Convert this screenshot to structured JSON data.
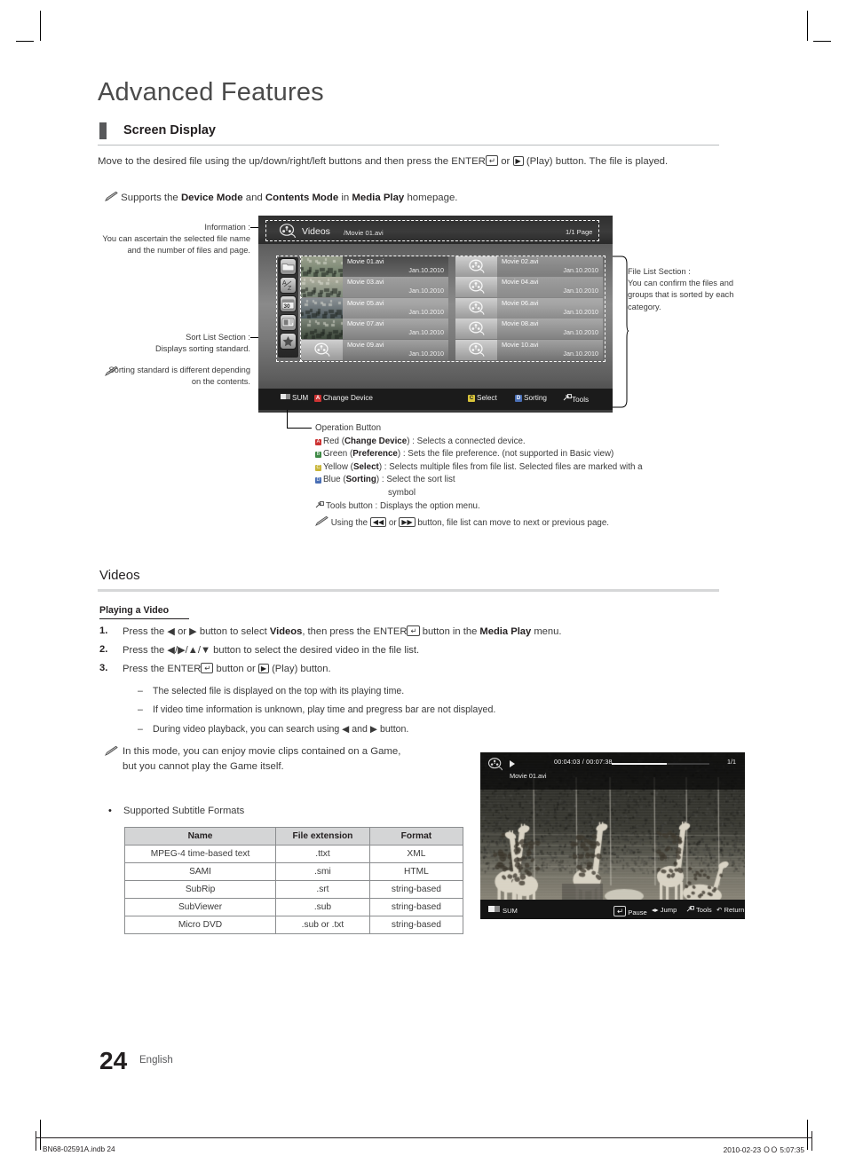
{
  "page": {
    "title": "Advanced Features",
    "number": "24",
    "language": "English"
  },
  "screen_display": {
    "heading": "Screen Display",
    "intro_1": "Move to the desired file using the up/down/right/left buttons and then press the ENTER",
    "intro_enter_key": "↵",
    "intro_2": "or",
    "intro_play_key": "▶",
    "intro_3": "(Play) button. The file is played.",
    "note_pre": "Supports the ",
    "note_b1": "Device Mode",
    "note_mid1": " and ",
    "note_b2": "Contents Mode",
    "note_mid2": " in ",
    "note_b3": "Media Play",
    "note_end": " homepage."
  },
  "callouts": {
    "information": {
      "title": "Information :",
      "body": "You can ascertain the selected file name and the number of files and page."
    },
    "sort_list": {
      "title": "Sort List Section :",
      "body": "Displays sorting standard.",
      "note": "Sorting standard is different depending on the contents."
    },
    "file_list": {
      "title": "File List Section :",
      "body": "You can confirm the files and groups that is sorted by each category."
    }
  },
  "tv_screen": {
    "header": {
      "icon": "film-reel-icon",
      "title": "Videos",
      "path": "/Movie 01.avi",
      "page": "1/1 Page"
    },
    "sort_icons": [
      "folder-icon",
      "alphabetical-a-z-icon",
      "calendar-30-icon",
      "monitor-icon",
      "star-favorite-icon"
    ],
    "files": [
      {
        "name": "Movie 01.avi",
        "date": "Jan.10.2010",
        "thumb": "photo",
        "selected": true
      },
      {
        "name": "Movie 02.avi",
        "date": "Jan.10.2010",
        "thumb": "reel",
        "selected": false
      },
      {
        "name": "Movie 03.avi",
        "date": "Jan.10.2010",
        "thumb": "photo",
        "selected": false
      },
      {
        "name": "Movie 04.avi",
        "date": "Jan.10.2010",
        "thumb": "reel",
        "selected": false
      },
      {
        "name": "Movie 05.avi",
        "date": "Jan.10.2010",
        "thumb": "photo",
        "selected": false
      },
      {
        "name": "Movie 06.avi",
        "date": "Jan.10.2010",
        "thumb": "reel",
        "selected": false
      },
      {
        "name": "Movie 07.avi",
        "date": "Jan.10.2010",
        "thumb": "photo",
        "selected": false
      },
      {
        "name": "Movie 08.avi",
        "date": "Jan.10.2010",
        "thumb": "reel",
        "selected": false
      },
      {
        "name": "Movie 09.avi",
        "date": "Jan.10.2010",
        "thumb": "reel",
        "selected": false
      },
      {
        "name": "Movie 10.avi",
        "date": "Jan.10.2010",
        "thumb": "reel",
        "selected": false
      }
    ],
    "op_bar": {
      "sum": "SUM",
      "change_device_key": "A",
      "change_device": "Change Device",
      "select_key": "C",
      "select": "Select",
      "sorting_key": "D",
      "sorting": "Sorting",
      "tools": "Tools"
    }
  },
  "operation_button": {
    "title": "Operation Button",
    "rows": [
      {
        "key": "A",
        "pre": "Red (",
        "bold": "Change Device",
        "post": ") : Selects a connected device."
      },
      {
        "key": "B",
        "pre": "Green (",
        "bold": "Preference",
        "post": ")  : Sets the file preference. (not supported in Basic view)"
      },
      {
        "key": "C",
        "pre": "Yellow (",
        "bold": "Select",
        "post": ") : Selects multiple files from file list. Selected files are marked with a"
      },
      {
        "key": "D",
        "pre": "Blue (",
        "bold": "Sorting",
        "post": ")  : Select the sort list"
      }
    ],
    "yellow_continuation": "symbol",
    "tools_row": "Tools button : Displays the option menu.",
    "note_pre": "Using the ",
    "note_key_rew": "◀◀",
    "note_mid": " or ",
    "note_key_ff": "▶▶",
    "note_post": " button, file list can move to next or previous page."
  },
  "videos": {
    "heading": "Videos",
    "subheading": "Playing a Video",
    "steps": [
      {
        "num": "1.",
        "parts": [
          "Press the ◀ or ▶ button to select ",
          "Videos",
          ", then press the ENTER",
          " button in the ",
          "Media Play",
          " menu."
        ]
      },
      {
        "num": "2.",
        "parts": [
          "Press the ◀/▶/▲/▼ button to select the desired video in the file list."
        ]
      },
      {
        "num": "3.",
        "parts": [
          "Press the ENTER",
          " button or ",
          " (Play) button."
        ]
      }
    ],
    "bullets": [
      "The selected file is displayed on the top with its playing time.",
      "If video time information is unknown, play time and pregress bar are not displayed.",
      "During video playback, you can search using ◀ and ▶ button."
    ],
    "note_line1": "In this mode, you can enjoy movie clips contained on a Game,",
    "note_line2": "but you cannot play the Game itself."
  },
  "playback_screen": {
    "icon": "film-reel-icon",
    "play_icon": "play-icon",
    "time": "00:04:03 / 00:07:38",
    "page": "1/1",
    "file": "Movie 01.avi",
    "progress_percent": 56,
    "sum": "SUM",
    "pause": "Pause",
    "jump": "Jump",
    "tools": "Tools",
    "return": "Return"
  },
  "subtitle_table": {
    "label": "Supported Subtitle Formats",
    "headers": [
      "Name",
      "File extension",
      "Format"
    ],
    "rows": [
      [
        "MPEG-4 time-based text",
        ".ttxt",
        "XML"
      ],
      [
        "SAMI",
        ".smi",
        "HTML"
      ],
      [
        "SubRip",
        ".srt",
        "string-based"
      ],
      [
        "SubViewer",
        ".sub",
        "string-based"
      ],
      [
        "Micro DVD",
        ".sub or .txt",
        "string-based"
      ]
    ]
  },
  "footer": {
    "left": "BN68-02591A.indb   24",
    "right": "2010-02-23   ＯＯ 5:07:35"
  }
}
